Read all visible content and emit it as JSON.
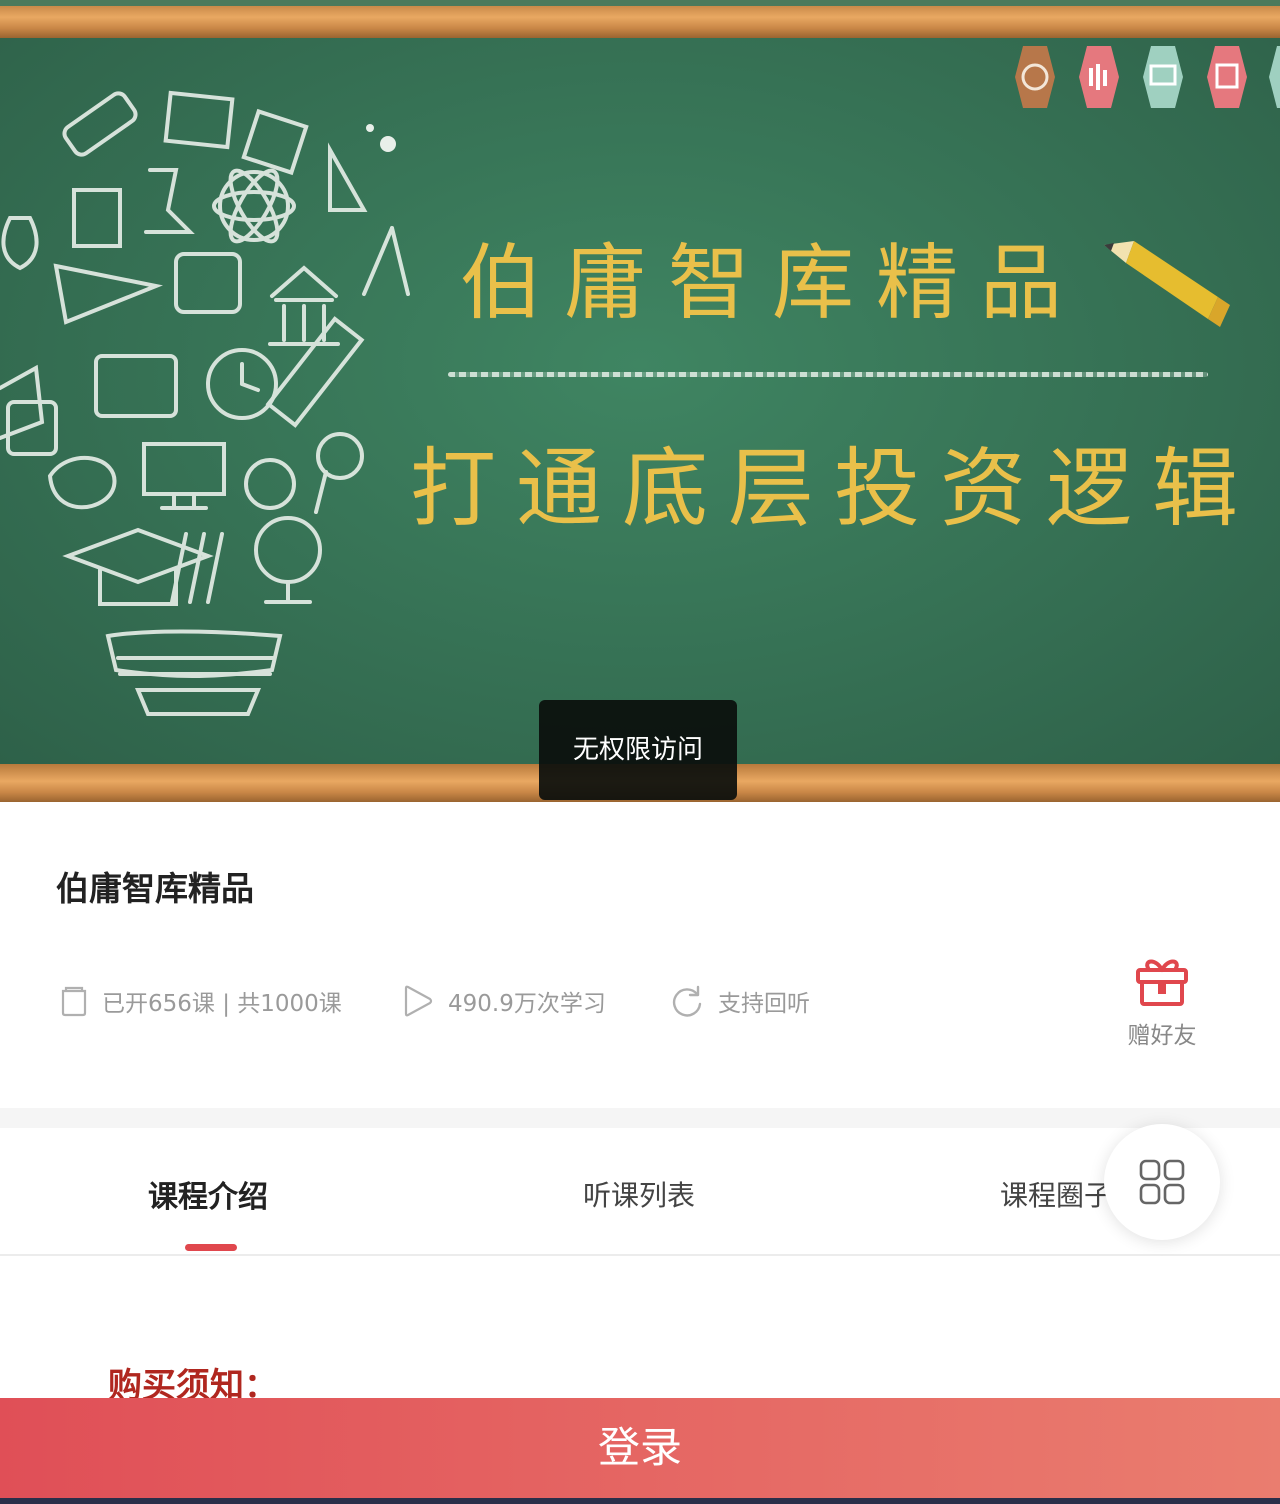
{
  "banner": {
    "headline": "伯庸智库精品",
    "subline": "打通底层投资逻辑",
    "overlay_message": "无权限访问",
    "colors": {
      "board": "#357556",
      "chalk_text": "#e9c04a"
    }
  },
  "course": {
    "title": "伯庸智库精品",
    "meta": {
      "lessons_text": "已开656课 | 共1000课",
      "lessons_icon": "document-icon",
      "views_text": "490.9万次学习",
      "views_icon": "play-icon",
      "replay_text": "支持回听",
      "replay_icon": "refresh-icon"
    },
    "gift": {
      "label": "赠好友",
      "icon": "gift-icon"
    }
  },
  "tabs": [
    {
      "label": "课程介绍",
      "active": true
    },
    {
      "label": "听课列表",
      "active": false
    },
    {
      "label": "课程圈子",
      "active": false
    }
  ],
  "menu_icon": "grid-icon",
  "content": {
    "notice_title": "购买须知："
  },
  "login": {
    "label": "登录"
  },
  "colors": {
    "accent": "#e0474d",
    "login_start": "#e04f57",
    "login_end": "#ea7d6f",
    "notice": "#b0271f"
  }
}
